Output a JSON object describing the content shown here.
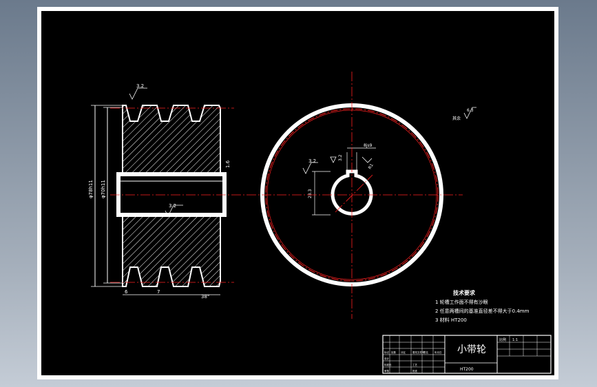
{
  "drawing": {
    "title": "小带轮",
    "material": "HT200",
    "background": "#000000",
    "line_color": "#ffffff",
    "center_line_color": "#ff2020",
    "dimension_color": "#ffffff"
  },
  "requirements": {
    "heading": "技术要求",
    "items": [
      "1 轮槽工作面不得有沙眼",
      "2 任意两槽间的基准直径差不得大于0.4mm",
      "3 材料 HT200"
    ]
  },
  "roughness": {
    "groove": "3.2",
    "bore_left": "3.2",
    "bore_mid": "3.2",
    "keyway": "3.2",
    "other": "6.3",
    "other_label": "其余"
  },
  "dimensions": {
    "outer_diameter": "φ78h11",
    "inner_diameter": "φ70h11",
    "keyway_width": "8js9",
    "bore_height": "28.3",
    "groove_pitch": "7",
    "groove_start": "6",
    "groove_angle": "38°",
    "chamfer": "R1",
    "right_dim": "1.6"
  },
  "title_block": {
    "ratio_label": "比例",
    "ratio_value": "1:1",
    "table_cells": [
      "标记",
      "处数",
      "分区",
      "更改文件号",
      "签名",
      "年月日",
      "设计",
      "标准化",
      "审核",
      "工艺",
      "批准"
    ]
  }
}
